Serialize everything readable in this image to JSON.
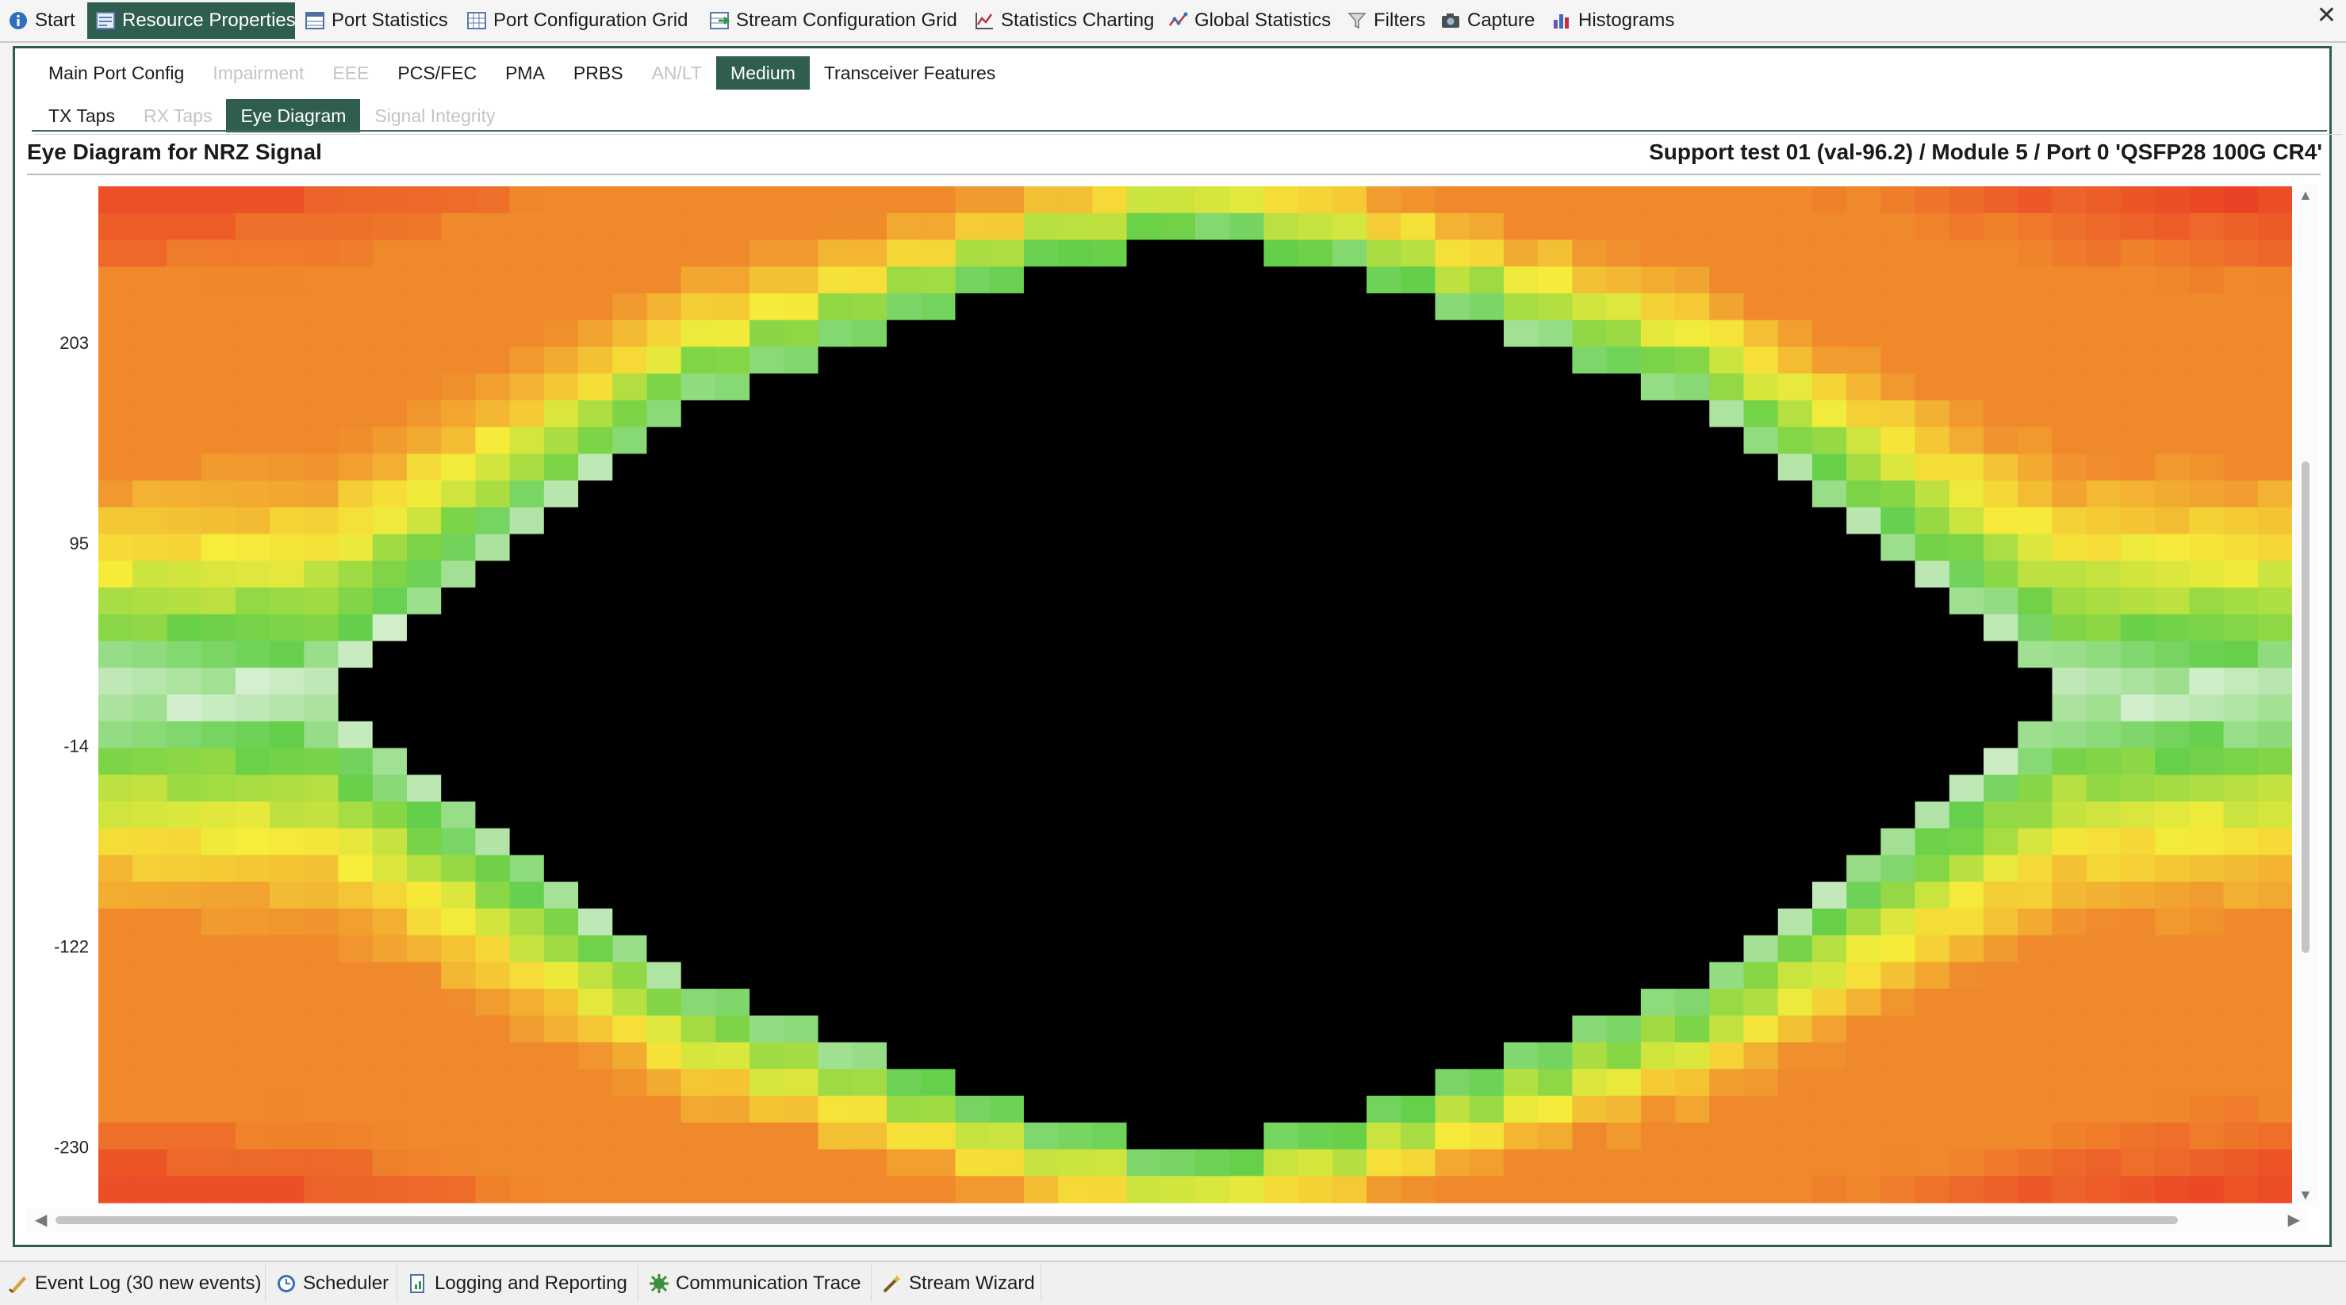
{
  "top_tabs": [
    {
      "label": "Start",
      "icon": "info-icon",
      "active": false
    },
    {
      "label": "Resource Properties",
      "icon": "properties-icon",
      "active": true
    },
    {
      "label": "Port Statistics",
      "icon": "table-icon",
      "active": false
    },
    {
      "label": "Port Configuration Grid",
      "icon": "grid-icon",
      "active": false
    },
    {
      "label": "Stream Configuration Grid",
      "icon": "stream-grid-icon",
      "active": false
    },
    {
      "label": "Statistics Charting",
      "icon": "chart-icon",
      "active": false
    },
    {
      "label": "Global Statistics",
      "icon": "global-chart-icon",
      "active": false
    },
    {
      "label": "Filters",
      "icon": "filter-icon",
      "active": false
    },
    {
      "label": "Capture",
      "icon": "camera-icon",
      "active": false
    },
    {
      "label": "Histograms",
      "icon": "histogram-icon",
      "active": false
    }
  ],
  "sub_tabs": [
    {
      "label": "Main Port Config",
      "state": "normal"
    },
    {
      "label": "Impairment",
      "state": "disabled"
    },
    {
      "label": "EEE",
      "state": "disabled"
    },
    {
      "label": "PCS/FEC",
      "state": "normal"
    },
    {
      "label": "PMA",
      "state": "normal"
    },
    {
      "label": "PRBS",
      "state": "normal"
    },
    {
      "label": "AN/LT",
      "state": "disabled"
    },
    {
      "label": "Medium",
      "state": "active"
    },
    {
      "label": "Transceiver Features",
      "state": "normal"
    }
  ],
  "medium_tabs": [
    {
      "label": "TX Taps",
      "state": "normal"
    },
    {
      "label": "RX Taps",
      "state": "disabled"
    },
    {
      "label": "Eye Diagram",
      "state": "active"
    },
    {
      "label": "Signal Integrity",
      "state": "disabled"
    }
  ],
  "title_left": "Eye Diagram for NRZ Signal",
  "title_right": "Support test 01  (val-96.2) / Module 5 / Port 0 'QSFP28 100G CR4'",
  "chart_data": {
    "type": "heatmap",
    "y_ticks": [
      203,
      95,
      -14,
      -122,
      -230
    ],
    "ylim": [
      -260,
      287
    ],
    "columns": 64,
    "rows": 38,
    "eye_opening_rows_by_column_from_edge": [
      0,
      0,
      0,
      0,
      0,
      0,
      0,
      1,
      2,
      3,
      4,
      5,
      6,
      7,
      8,
      9,
      10,
      11,
      11,
      12,
      12,
      13,
      13,
      14,
      14,
      15,
      15,
      16,
      16,
      16,
      17,
      17
    ],
    "colors": {
      "outer": "#ea3d25",
      "orange": "#f0882c",
      "yellow": "#f6ec3a",
      "green": "#63cf4a",
      "white": "#f6f7f6",
      "eye": "#000000"
    }
  },
  "bottom_tabs": [
    {
      "label": "Event Log (30 new events)",
      "icon": "event-log-icon"
    },
    {
      "label": "Scheduler",
      "icon": "scheduler-icon"
    },
    {
      "label": "Logging and Reporting",
      "icon": "report-icon"
    },
    {
      "label": "Communication Trace",
      "icon": "trace-icon"
    },
    {
      "label": "Stream Wizard",
      "icon": "wizard-icon"
    }
  ]
}
